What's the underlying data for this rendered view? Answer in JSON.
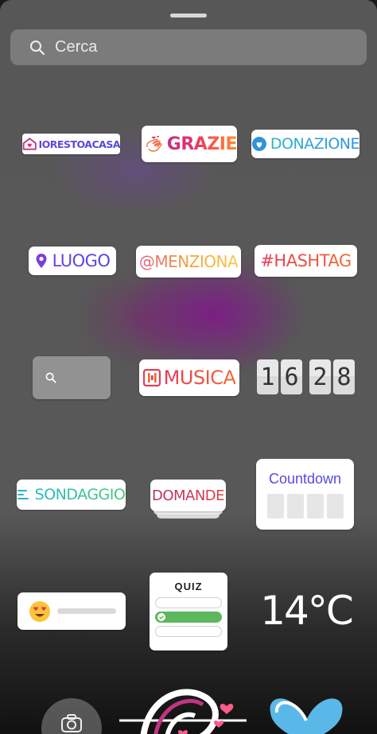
{
  "search": {
    "placeholder": "Cerca",
    "icon": "search-icon"
  },
  "stickers": {
    "iorestoacasa": "IORESTOACASA",
    "grazie": "GRAZIE",
    "donazione": "DONAZIONE",
    "luogo": "LUOGO",
    "menziona": "@MENZIONA",
    "hashtag": "#HASHTAG",
    "musica": "MUSICA",
    "clock_digits": [
      "1",
      "6",
      "2",
      "8"
    ],
    "sondaggio": "SONDAGGIO",
    "domande": "DOMANDE",
    "countdown": "Countdown",
    "quiz": "QUIZ",
    "temperature": "14°C"
  },
  "colors": {
    "background": "#575757",
    "sticker_bg": "#ffffff",
    "quiz_correct": "#5cb85c"
  }
}
